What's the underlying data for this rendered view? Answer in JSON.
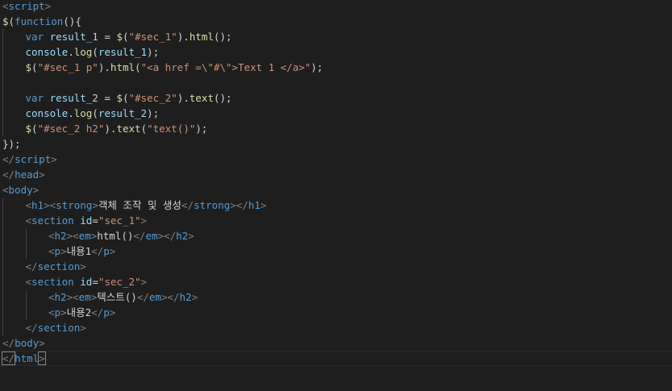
{
  "colors": {
    "background": "#1e1e1e",
    "tag": "#569cd6",
    "bracket": "#808080",
    "attribute": "#9cdcfe",
    "string": "#ce9178",
    "keyword": "#569cd6",
    "identifier": "#9cdcfe",
    "function": "#dcdcaa",
    "punctuation": "#d4d4d4",
    "text": "#d4d4d4"
  },
  "lines": [
    {
      "indent": 0,
      "tokens": [
        [
          "<",
          "bracket"
        ],
        [
          "script",
          "tag"
        ],
        [
          ">",
          "bracket"
        ]
      ]
    },
    {
      "indent": 0,
      "tokens": [
        [
          "$",
          "function"
        ],
        [
          "(",
          "punctuation"
        ],
        [
          "function",
          "keyword"
        ],
        [
          "(){",
          "punctuation"
        ]
      ]
    },
    {
      "indent": 1,
      "tokens": [
        [
          "var",
          "keyword"
        ],
        [
          " ",
          "text"
        ],
        [
          "result_1",
          "identifier"
        ],
        [
          " = ",
          "punctuation"
        ],
        [
          "$",
          "function"
        ],
        [
          "(",
          "punctuation"
        ],
        [
          "\"#sec_1\"",
          "string"
        ],
        [
          ").",
          "punctuation"
        ],
        [
          "html",
          "function"
        ],
        [
          "();",
          "punctuation"
        ]
      ]
    },
    {
      "indent": 1,
      "tokens": [
        [
          "console",
          "identifier"
        ],
        [
          ".",
          "punctuation"
        ],
        [
          "log",
          "function"
        ],
        [
          "(",
          "punctuation"
        ],
        [
          "result_1",
          "identifier"
        ],
        [
          ");",
          "punctuation"
        ]
      ]
    },
    {
      "indent": 1,
      "tokens": [
        [
          "$",
          "function"
        ],
        [
          "(",
          "punctuation"
        ],
        [
          "\"#sec_1 p\"",
          "string"
        ],
        [
          ").",
          "punctuation"
        ],
        [
          "html",
          "function"
        ],
        [
          "(",
          "punctuation"
        ],
        [
          "\"<a href =\\\"#\\\">Text 1 </a>\"",
          "string"
        ],
        [
          ");",
          "punctuation"
        ]
      ]
    },
    {
      "indent": 1,
      "tokens": []
    },
    {
      "indent": 1,
      "tokens": [
        [
          "var",
          "keyword"
        ],
        [
          " ",
          "text"
        ],
        [
          "result_2",
          "identifier"
        ],
        [
          " = ",
          "punctuation"
        ],
        [
          "$",
          "function"
        ],
        [
          "(",
          "punctuation"
        ],
        [
          "\"#sec_2\"",
          "string"
        ],
        [
          ").",
          "punctuation"
        ],
        [
          "text",
          "function"
        ],
        [
          "();",
          "punctuation"
        ]
      ]
    },
    {
      "indent": 1,
      "tokens": [
        [
          "console",
          "identifier"
        ],
        [
          ".",
          "punctuation"
        ],
        [
          "log",
          "function"
        ],
        [
          "(",
          "punctuation"
        ],
        [
          "result_2",
          "identifier"
        ],
        [
          ");",
          "punctuation"
        ]
      ]
    },
    {
      "indent": 1,
      "tokens": [
        [
          "$",
          "function"
        ],
        [
          "(",
          "punctuation"
        ],
        [
          "\"#sec_2 h2\"",
          "string"
        ],
        [
          ").",
          "punctuation"
        ],
        [
          "text",
          "function"
        ],
        [
          "(",
          "punctuation"
        ],
        [
          "\"text()\"",
          "string"
        ],
        [
          ");",
          "punctuation"
        ]
      ]
    },
    {
      "indent": 0,
      "tokens": [
        [
          "});",
          "punctuation"
        ]
      ]
    },
    {
      "indent": 0,
      "tokens": [
        [
          "</",
          "bracket"
        ],
        [
          "script",
          "tag"
        ],
        [
          ">",
          "bracket"
        ]
      ]
    },
    {
      "indent": 0,
      "tokens": [
        [
          "</",
          "bracket"
        ],
        [
          "head",
          "tag"
        ],
        [
          ">",
          "bracket"
        ]
      ]
    },
    {
      "indent": 0,
      "tokens": [
        [
          "<",
          "bracket"
        ],
        [
          "body",
          "tag"
        ],
        [
          ">",
          "bracket"
        ]
      ]
    },
    {
      "indent": 1,
      "tokens": [
        [
          "<",
          "bracket"
        ],
        [
          "h1",
          "tag"
        ],
        [
          "><",
          "bracket"
        ],
        [
          "strong",
          "tag"
        ],
        [
          ">",
          "bracket"
        ],
        [
          "객체 조작 및 생성",
          "text"
        ],
        [
          "</",
          "bracket"
        ],
        [
          "strong",
          "tag"
        ],
        [
          "></",
          "bracket"
        ],
        [
          "h1",
          "tag"
        ],
        [
          ">",
          "bracket"
        ]
      ]
    },
    {
      "indent": 1,
      "tokens": [
        [
          "<",
          "bracket"
        ],
        [
          "section",
          "tag"
        ],
        [
          " ",
          "text"
        ],
        [
          "id",
          "attribute"
        ],
        [
          "=",
          "punctuation"
        ],
        [
          "\"sec_1\"",
          "string"
        ],
        [
          ">",
          "bracket"
        ]
      ]
    },
    {
      "indent": 2,
      "tokens": [
        [
          "<",
          "bracket"
        ],
        [
          "h2",
          "tag"
        ],
        [
          "><",
          "bracket"
        ],
        [
          "em",
          "tag"
        ],
        [
          ">",
          "bracket"
        ],
        [
          "html()",
          "text"
        ],
        [
          "</",
          "bracket"
        ],
        [
          "em",
          "tag"
        ],
        [
          "></",
          "bracket"
        ],
        [
          "h2",
          "tag"
        ],
        [
          ">",
          "bracket"
        ]
      ]
    },
    {
      "indent": 2,
      "tokens": [
        [
          "<",
          "bracket"
        ],
        [
          "p",
          "tag"
        ],
        [
          ">",
          "bracket"
        ],
        [
          "내용1",
          "text"
        ],
        [
          "</",
          "bracket"
        ],
        [
          "p",
          "tag"
        ],
        [
          ">",
          "bracket"
        ]
      ]
    },
    {
      "indent": 1,
      "tokens": [
        [
          "</",
          "bracket"
        ],
        [
          "section",
          "tag"
        ],
        [
          ">",
          "bracket"
        ]
      ]
    },
    {
      "indent": 1,
      "tokens": [
        [
          "<",
          "bracket"
        ],
        [
          "section",
          "tag"
        ],
        [
          " ",
          "text"
        ],
        [
          "id",
          "attribute"
        ],
        [
          "=",
          "punctuation"
        ],
        [
          "\"sec_2\"",
          "string"
        ],
        [
          ">",
          "bracket"
        ]
      ]
    },
    {
      "indent": 2,
      "tokens": [
        [
          "<",
          "bracket"
        ],
        [
          "h2",
          "tag"
        ],
        [
          "><",
          "bracket"
        ],
        [
          "em",
          "tag"
        ],
        [
          ">",
          "bracket"
        ],
        [
          "텍스트()",
          "text"
        ],
        [
          "</",
          "bracket"
        ],
        [
          "em",
          "tag"
        ],
        [
          "></",
          "bracket"
        ],
        [
          "h2",
          "tag"
        ],
        [
          ">",
          "bracket"
        ]
      ]
    },
    {
      "indent": 2,
      "tokens": [
        [
          "<",
          "bracket"
        ],
        [
          "p",
          "tag"
        ],
        [
          ">",
          "bracket"
        ],
        [
          "내용2",
          "text"
        ],
        [
          "</",
          "bracket"
        ],
        [
          "p",
          "tag"
        ],
        [
          ">",
          "bracket"
        ]
      ]
    },
    {
      "indent": 1,
      "tokens": [
        [
          "</",
          "bracket"
        ],
        [
          "section",
          "tag"
        ],
        [
          ">",
          "bracket"
        ]
      ]
    },
    {
      "indent": 0,
      "tokens": [
        [
          "</",
          "bracket"
        ],
        [
          "body",
          "tag"
        ],
        [
          ">",
          "bracket"
        ]
      ]
    },
    {
      "indent": 0,
      "current": true,
      "tokens": [
        [
          "</",
          "bracket"
        ],
        [
          "html",
          "tag"
        ],
        [
          ">",
          "bracket"
        ]
      ]
    }
  ]
}
